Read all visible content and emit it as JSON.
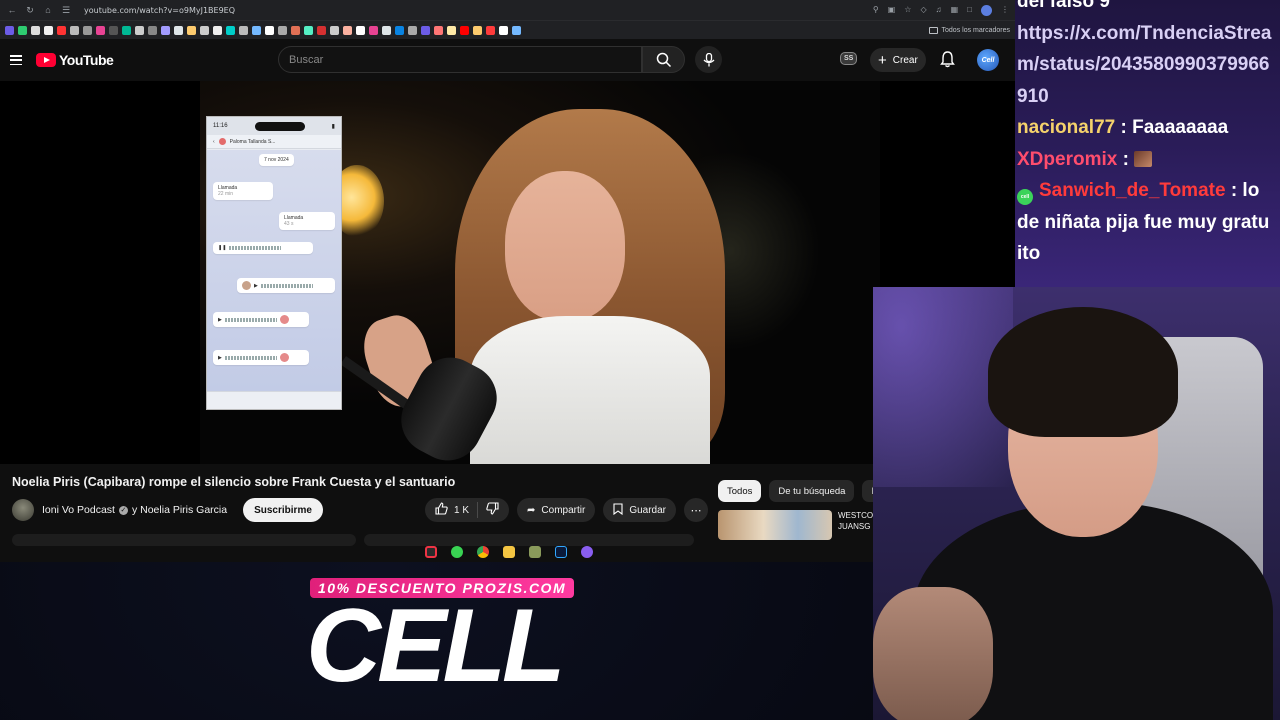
{
  "browser": {
    "url": "youtube.com/watch?v=o9MyJ1BE9EQ",
    "bookmarks_more": "Todos los marcadores"
  },
  "youtube": {
    "logo_text": "YouTube",
    "search_placeholder": "Buscar",
    "ss_badge": "SS",
    "create_label": "Crear",
    "avatar_label": "Cell"
  },
  "video": {
    "phone": {
      "time": "11:16",
      "contact": "Paloma Tallanda S...",
      "date": "7 nov 2024",
      "call1_label": "Llamada",
      "call1_detail": "22 min",
      "call2_label": "Llamada",
      "call2_detail": "43 s"
    }
  },
  "watch": {
    "title": "Noelia Piris (Capibara) rompe el silencio sobre Frank Cuesta y el santuario",
    "channel": "Ioni Vo Podcast",
    "channel_and": "y Noelia Piris Garcia",
    "subscribe_label": "Suscribirme",
    "likes": "1 K",
    "share_label": "Compartir",
    "save_label": "Guardar"
  },
  "sidebar": {
    "chips": [
      "Todos",
      "De tu búsqueda",
      "Ioni"
    ],
    "related_title_line1": "WESTCO",
    "related_title_line2": "JUANSG"
  },
  "chat": {
    "lines": [
      {
        "name": "",
        "text": "del falso 9"
      },
      {
        "name": "",
        "text": "https://x.com/TndenciaStream/status/2043580990379966910"
      },
      {
        "name": "nacional77",
        "text": " : Faaaaaaaa",
        "color": "#f5d26b"
      },
      {
        "name": "XDperomix",
        "text": " : ",
        "color": "#ff4d6d"
      },
      {
        "name": "Sanwich_de_Tomate",
        "text": " : lo de niñata pija fue muy gratuito",
        "color": "#ff3b3b"
      }
    ],
    "badge_label": "cell"
  },
  "sponsor": {
    "tag": "10% DESCUENTO PROZIS.COM",
    "brand": "CELL"
  },
  "colors": {
    "yt_red": "#ff0033",
    "chat_bg": "#2a1c58",
    "sponsor_pink": "#e0207a"
  }
}
